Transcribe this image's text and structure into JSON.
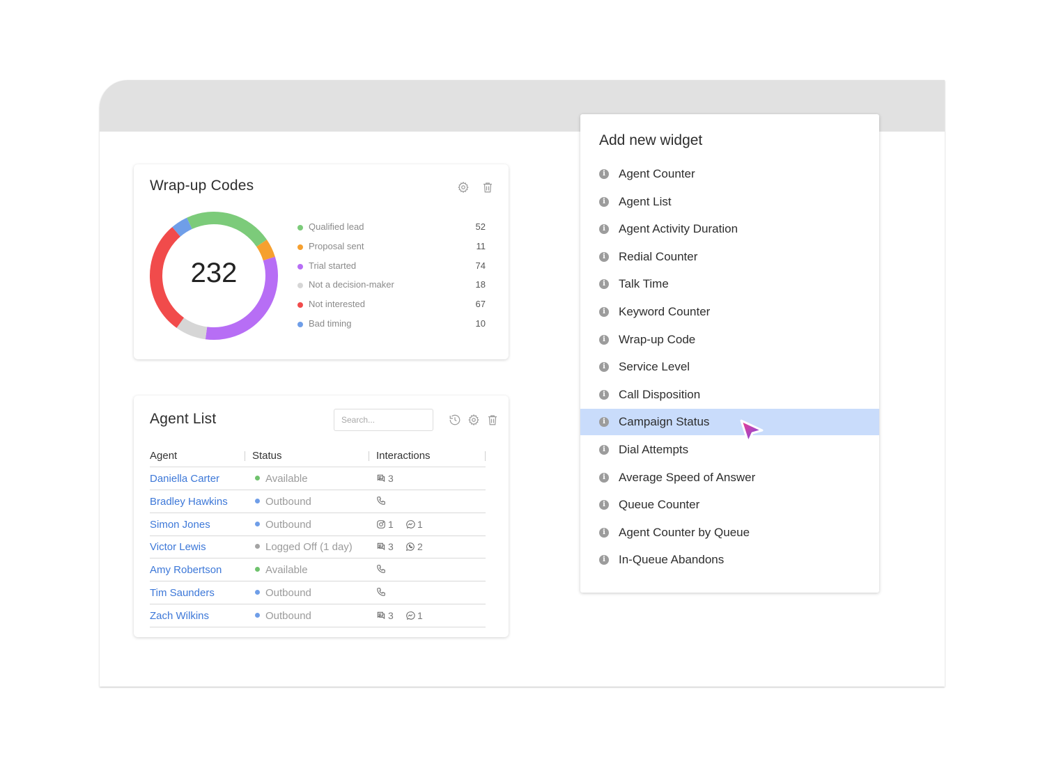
{
  "wrapup": {
    "title": "Wrap-up Codes",
    "total": "232",
    "items": [
      {
        "label": "Qualified lead",
        "value": 52,
        "color": "#7ccb7a"
      },
      {
        "label": "Proposal sent",
        "value": 11,
        "color": "#f6a02f"
      },
      {
        "label": "Trial started",
        "value": 74,
        "color": "#b76ef5"
      },
      {
        "label": "Not a decision-maker",
        "value": 18,
        "color": "#d6d6d6"
      },
      {
        "label": "Not interested",
        "value": 67,
        "color": "#f14b4b"
      },
      {
        "label": "Bad timing",
        "value": 10,
        "color": "#6f9ee8"
      }
    ]
  },
  "chart_data": {
    "type": "pie",
    "categories": [
      "Qualified lead",
      "Proposal sent",
      "Trial started",
      "Not a decision-maker",
      "Not interested",
      "Bad timing"
    ],
    "values": [
      52,
      11,
      74,
      18,
      67,
      10
    ],
    "title": "Wrap-up Codes"
  },
  "agents": {
    "title": "Agent List",
    "search_placeholder": "Search...",
    "columns": [
      "Agent",
      "Status",
      "Interactions"
    ],
    "rows": [
      {
        "name": "Daniella Carter",
        "status": "Available",
        "status_color": "#6fc26d",
        "interactions": [
          {
            "icon": "chat-icon",
            "count": "3"
          }
        ]
      },
      {
        "name": "Bradley Hawkins",
        "status": "Outbound",
        "status_color": "#6f9ee8",
        "interactions": [
          {
            "icon": "phone-icon",
            "count": ""
          }
        ]
      },
      {
        "name": "Simon Jones",
        "status": "Outbound",
        "status_color": "#6f9ee8",
        "interactions": [
          {
            "icon": "instagram-icon",
            "count": "1"
          },
          {
            "icon": "messenger-icon",
            "count": "1"
          }
        ]
      },
      {
        "name": "Victor Lewis",
        "status": "Logged Off (1 day)",
        "status_color": "#a3a3a3",
        "interactions": [
          {
            "icon": "chat-icon",
            "count": "3"
          },
          {
            "icon": "whatsapp-icon",
            "count": "2"
          }
        ]
      },
      {
        "name": "Amy Robertson",
        "status": "Available",
        "status_color": "#6fc26d",
        "interactions": [
          {
            "icon": "phone-icon",
            "count": ""
          }
        ]
      },
      {
        "name": "Tim Saunders",
        "status": "Outbound",
        "status_color": "#6f9ee8",
        "interactions": [
          {
            "icon": "phone-icon",
            "count": ""
          }
        ]
      },
      {
        "name": "Zach Wilkins",
        "status": "Outbound",
        "status_color": "#6f9ee8",
        "interactions": [
          {
            "icon": "chat-icon",
            "count": "3"
          },
          {
            "icon": "messenger-icon",
            "count": "1"
          }
        ]
      }
    ]
  },
  "panel": {
    "title": "Add new widget",
    "selected": "Campaign Status",
    "items": [
      "Agent Counter",
      "Agent List",
      "Agent Activity Duration",
      "Redial Counter",
      "Talk Time",
      "Keyword Counter",
      "Wrap-up Code",
      "Service Level",
      "Call Disposition",
      "Campaign Status",
      "Dial Attempts",
      "Average Speed of Answer",
      "Queue Counter",
      "Agent Counter by Queue",
      "In-Queue Abandons"
    ]
  }
}
